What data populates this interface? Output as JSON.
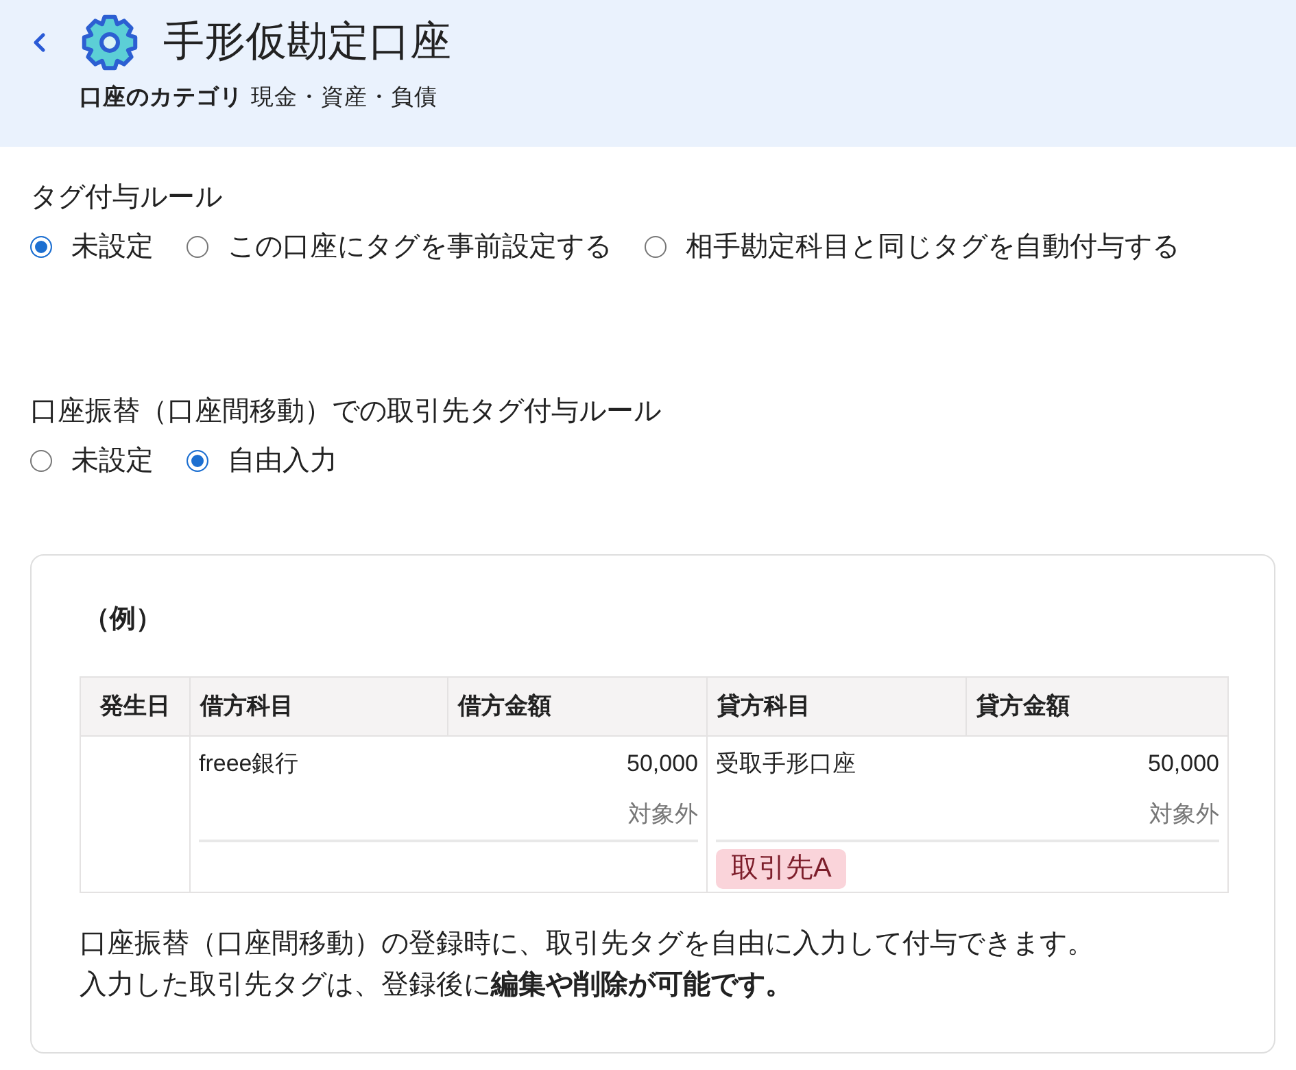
{
  "header": {
    "title": "手形仮勘定口座",
    "category_label": "口座のカテゴリ",
    "category_value": "現金・資産・負債"
  },
  "tag_rule": {
    "label": "タグ付与ルール",
    "options": [
      {
        "label": "未設定",
        "selected": true
      },
      {
        "label": "この口座にタグを事前設定する",
        "selected": false
      },
      {
        "label": "相手勘定科目と同じタグを自動付与する",
        "selected": false
      }
    ]
  },
  "transfer_rule": {
    "label": "口座振替（口座間移動）での取引先タグ付与ルール",
    "options": [
      {
        "label": "未設定",
        "selected": false
      },
      {
        "label": "自由入力",
        "selected": true
      }
    ]
  },
  "example": {
    "title": "（例）",
    "table": {
      "columns": [
        "発生日",
        "借方科目",
        "借方金額",
        "貸方科目",
        "貸方金額"
      ],
      "rows": [
        {
          "debit": {
            "account": "freee銀行",
            "amount": "50,000",
            "tax": "対象外"
          },
          "credit": {
            "account": "受取手形口座",
            "amount": "50,000",
            "tax": "対象外",
            "tags": [
              "取引先A"
            ]
          }
        }
      ]
    },
    "description": [
      "口座振替（口座間移動）の登録時に、取引先タグを自由に入力して付与できます。",
      "入力した取引先タグは、登録後に**編集や削除が可能です。**"
    ]
  }
}
